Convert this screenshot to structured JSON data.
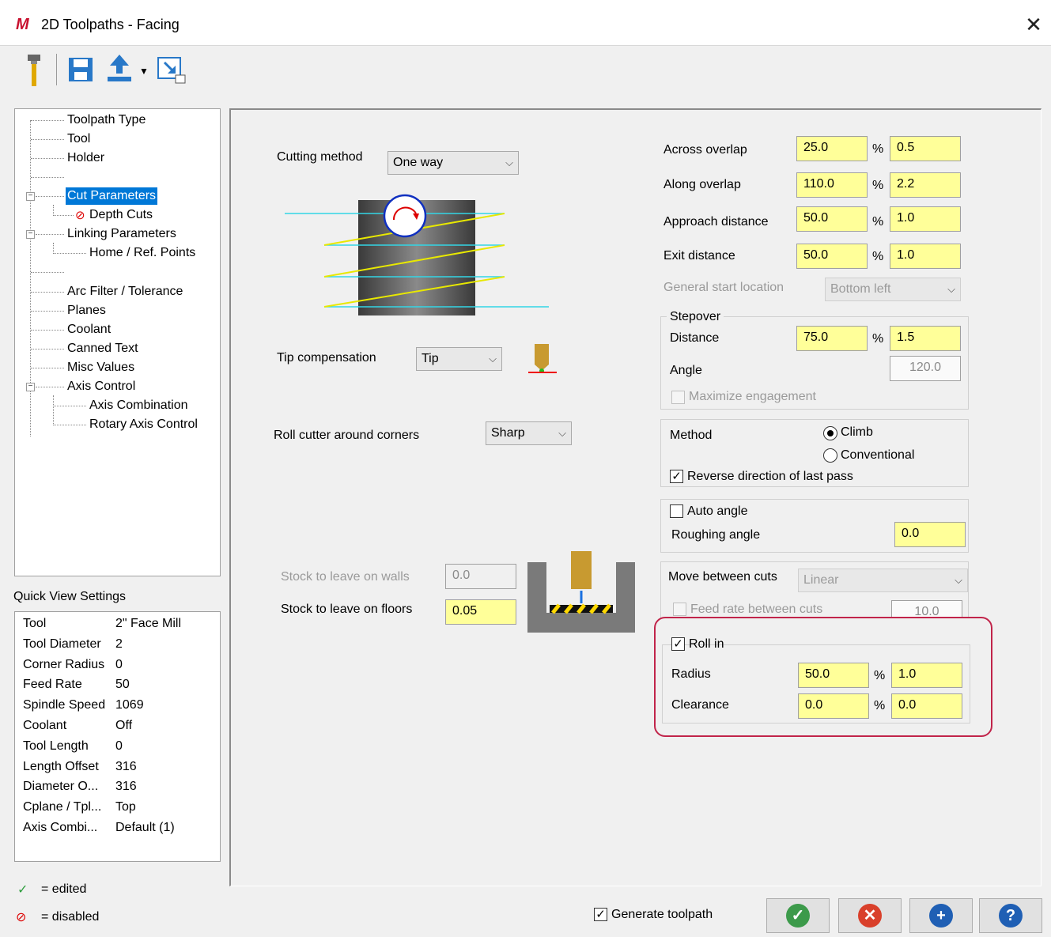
{
  "window": {
    "title": "2D Toolpaths - Facing",
    "close": "✕"
  },
  "tree": {
    "items": [
      {
        "label": "Toolpath Type"
      },
      {
        "label": "Tool"
      },
      {
        "label": "Holder"
      },
      {
        "label": "Cut Parameters"
      },
      {
        "label": "Depth Cuts"
      },
      {
        "label": "Linking Parameters"
      },
      {
        "label": "Home / Ref. Points"
      },
      {
        "label": "Arc Filter / Tolerance"
      },
      {
        "label": "Planes"
      },
      {
        "label": "Coolant"
      },
      {
        "label": "Canned Text"
      },
      {
        "label": "Misc Values"
      },
      {
        "label": "Axis Control"
      },
      {
        "label": "Axis Combination"
      },
      {
        "label": "Rotary Axis Control"
      }
    ],
    "selected": "Cut Parameters"
  },
  "quick_view": {
    "title": "Quick View Settings",
    "rows": [
      {
        "k": "Tool",
        "v": "2\" Face Mill"
      },
      {
        "k": "Tool Diameter",
        "v": "2"
      },
      {
        "k": "Corner Radius",
        "v": "0"
      },
      {
        "k": "Feed Rate",
        "v": "50"
      },
      {
        "k": "Spindle Speed",
        "v": "1069"
      },
      {
        "k": "Coolant",
        "v": "Off"
      },
      {
        "k": "Tool Length",
        "v": "0"
      },
      {
        "k": "Length Offset",
        "v": "316"
      },
      {
        "k": "Diameter O...",
        "v": "316"
      },
      {
        "k": "Cplane / Tpl...",
        "v": "Top"
      },
      {
        "k": "Axis Combi...",
        "v": "Default (1)"
      }
    ]
  },
  "legend": {
    "edited": "= edited",
    "disabled": "= disabled"
  },
  "left": {
    "cutting_method_label": "Cutting method",
    "cutting_method": "One way",
    "tip_comp_label": "Tip compensation",
    "tip_comp": "Tip",
    "roll_label": "Roll cutter around corners",
    "roll": "Sharp",
    "stock_walls_label": "Stock to leave on walls",
    "stock_walls": "0.0",
    "stock_floors_label": "Stock to leave on floors",
    "stock_floors": "0.05"
  },
  "right": {
    "across_label": "Across overlap",
    "across_pct": "25.0",
    "across_val": "0.5",
    "along_label": "Along overlap",
    "along_pct": "110.0",
    "along_val": "2.2",
    "approach_label": "Approach distance",
    "approach_pct": "50.0",
    "approach_val": "1.0",
    "exit_label": "Exit distance",
    "exit_pct": "50.0",
    "exit_val": "1.0",
    "start_label": "General start location",
    "start": "Bottom left",
    "stepover_title": "Stepover",
    "distance_label": "Distance",
    "distance_pct": "75.0",
    "distance_val": "1.5",
    "angle_label": "Angle",
    "angle": "120.0",
    "maximize_label": "Maximize engagement",
    "method_label": "Method",
    "climb": "Climb",
    "conventional": "Conventional",
    "reverse_label": "Reverse direction of last pass",
    "auto_angle_label": "Auto angle",
    "rough_angle_label": "Roughing angle",
    "rough_angle": "0.0",
    "move_label": "Move between cuts",
    "move": "Linear",
    "feed_between_label": "Feed rate between cuts",
    "feed_between": "10.0",
    "roll_in_label": "Roll in",
    "radius_label": "Radius",
    "radius_pct": "50.0",
    "radius_val": "1.0",
    "clearance_label": "Clearance",
    "clearance_pct": "0.0",
    "clearance_val": "0.0",
    "pct": "%"
  },
  "footer": {
    "generate_label": "Generate toolpath"
  },
  "colors": {
    "yellow_field": "#ffff99",
    "highlight": "#c1244a",
    "selected": "#0078d7",
    "ok": "#3c9a4a",
    "cancel": "#d9402b",
    "add": "#1f5fb4",
    "help": "#1f5fb4"
  }
}
